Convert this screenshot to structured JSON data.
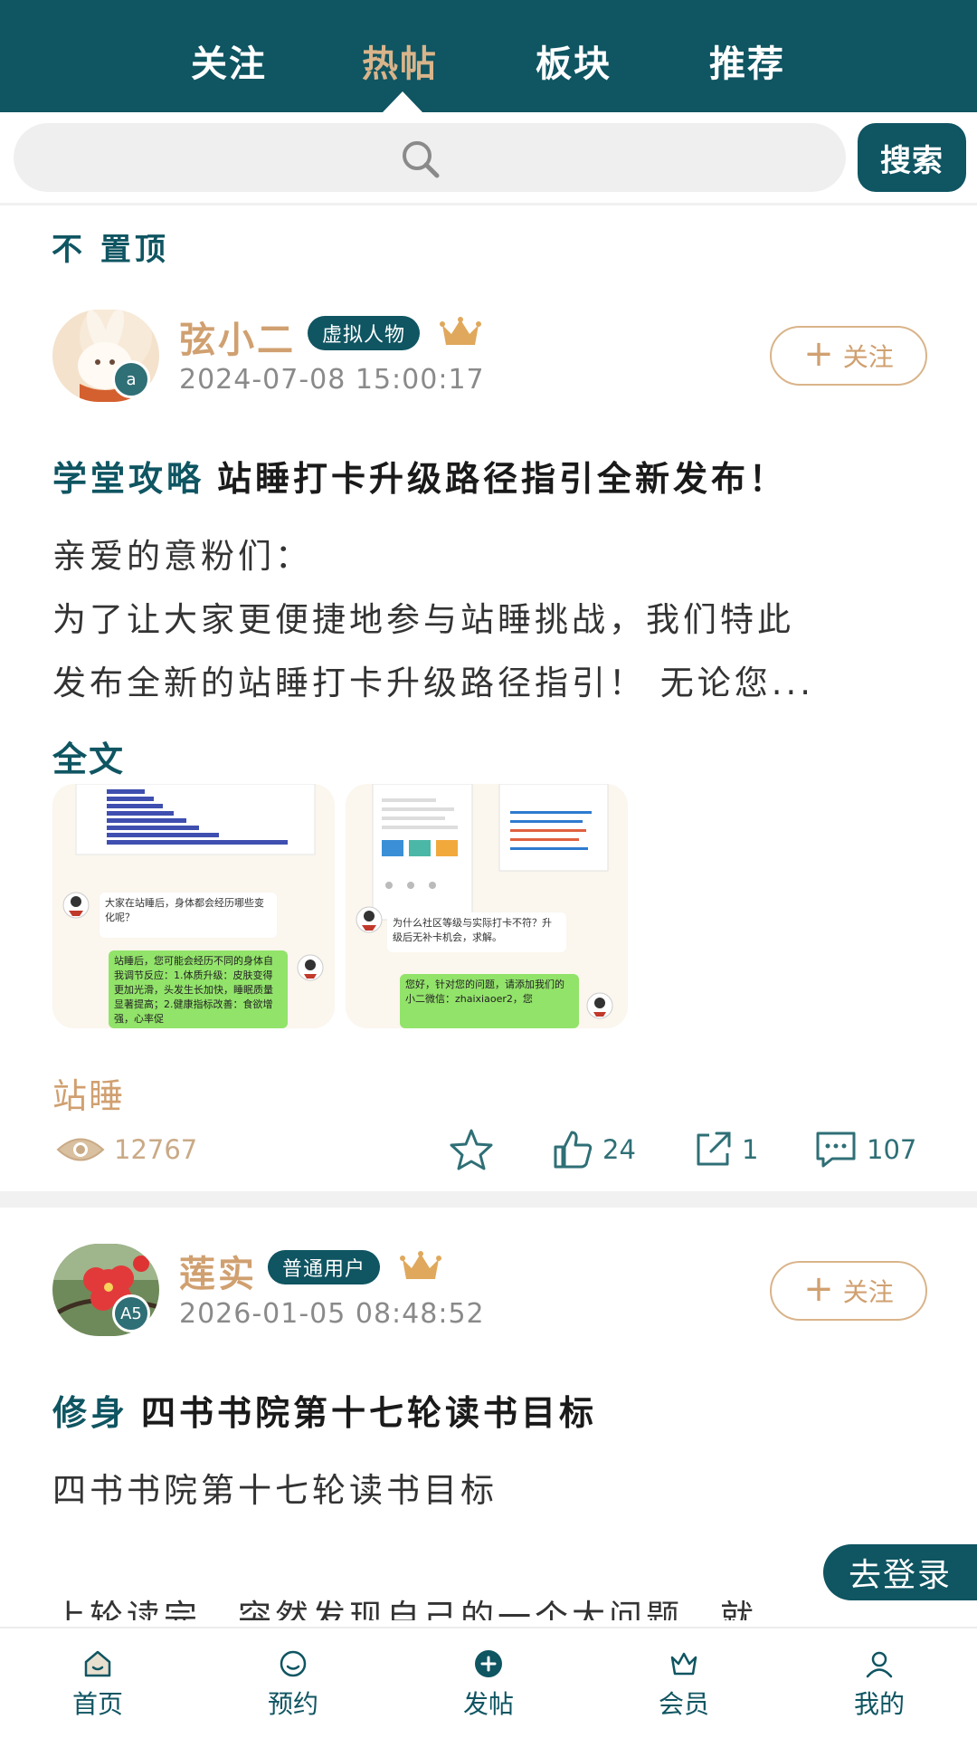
{
  "header": {
    "tabs": [
      {
        "label": "关注"
      },
      {
        "label": "热帖"
      },
      {
        "label": "板块"
      },
      {
        "label": "推荐"
      }
    ],
    "active_tab": "热帖"
  },
  "search": {
    "placeholder": "",
    "button_label": "搜索"
  },
  "pin_toggle_label": "不 置顶",
  "posts": [
    {
      "author": "弦小二",
      "role": "虚拟人物",
      "level": "a",
      "time": "2024-07-08 15:00:17",
      "follow_label": "关注",
      "category": "学堂攻略",
      "title": "站睡打卡升级路径指引全新发布！",
      "body_lines": [
        "亲爱的意粉们：",
        "为了让大家更便捷地参与站睡挑战，我们特此",
        "发布全新的站睡打卡升级路径指引！ 无论您..."
      ],
      "full_text_label": "全文",
      "thumbnails": [
        {
          "chat_q": "大家在站睡后，身体都会经历哪些变化呢？",
          "chat_a": "站睡后，您可能会经历不同的身体自我调节反应：1.体质升级：皮肤变得更加光滑，头发生长加快，睡眠质量显著提高；2.健康指标改善：食欲增强，心率促"
        },
        {
          "chat_q": "为什么社区等级与实际打卡不符？升级后无补卡机会，求解。",
          "chat_a": "您好，针对您的问题，请添加我们的小二微信：zhaixiaoer2，您"
        }
      ],
      "tag": "站睡",
      "views": "12767",
      "likes": "24",
      "shares": "1",
      "comments": "107"
    },
    {
      "author": "莲实",
      "role": "普通用户",
      "level": "A5",
      "time": "2026-01-05 08:48:52",
      "follow_label": "关注",
      "category": "修身",
      "title": "四书书院第十七轮读书目标",
      "body_lines": [
        "四书书院第十七轮读书目标",
        "",
        "上轮读完，突然发现自己的一个大问题，就"
      ]
    }
  ],
  "login_button_label": "去登录",
  "bottom_nav": [
    {
      "label": "首页",
      "icon": "home-icon"
    },
    {
      "label": "预约",
      "icon": "appointment-icon"
    },
    {
      "label": "发帖",
      "icon": "post-plus-icon"
    },
    {
      "label": "会员",
      "icon": "crown-icon"
    },
    {
      "label": "我的",
      "icon": "profile-icon"
    }
  ],
  "colors": {
    "primary": "#0f5562",
    "accent_gold": "#d0a070",
    "header_active": "#d9b48a",
    "gray_bg": "#efefef"
  }
}
